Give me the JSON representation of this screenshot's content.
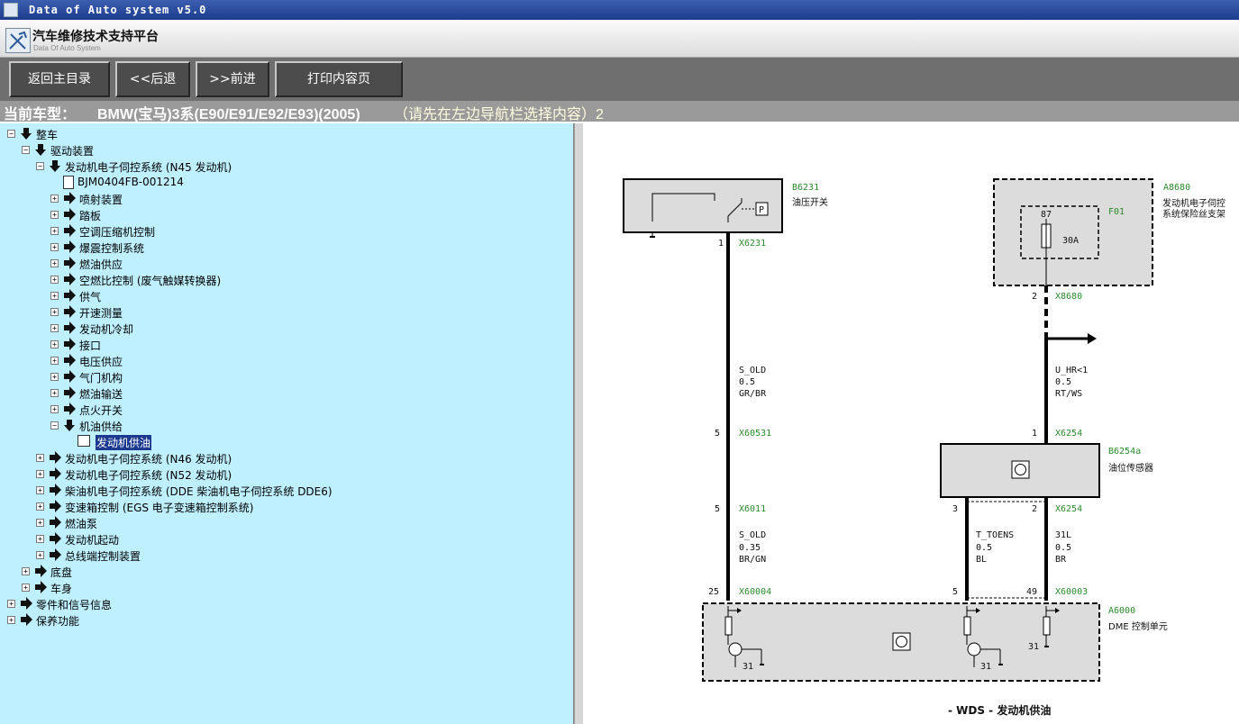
{
  "window": {
    "title": "Data of Auto system v5.0"
  },
  "brand": {
    "name": "汽车维修技术支持平台",
    "subtitle": "Data Of Auto System"
  },
  "toolbar": {
    "home": "返回主目录",
    "back": "<<后退",
    "forward": ">>前进",
    "print": "打印内容页"
  },
  "car": {
    "label": "当前车型：",
    "model": "BMW(宝马)3系(E90/E91/E92/E93)(2005)",
    "hint": "（请先在左边导航栏选择内容）2"
  },
  "tree": [
    {
      "label": "整车",
      "exp": "−",
      "arrow": "down"
    },
    {
      "label": "驱动装置",
      "exp": "−",
      "arrow": "down"
    },
    {
      "label": "发动机电子伺控系统 (N45 发动机)",
      "exp": "−",
      "arrow": "down"
    },
    {
      "label": "BJM0404FB-001214",
      "exp": "",
      "arrow": "doc"
    },
    {
      "label": "喷射装置",
      "exp": "+",
      "arrow": "right"
    },
    {
      "label": "踏板",
      "exp": "+",
      "arrow": "right"
    },
    {
      "label": "空调压缩机控制",
      "exp": "+",
      "arrow": "right"
    },
    {
      "label": "爆震控制系统",
      "exp": "+",
      "arrow": "right"
    },
    {
      "label": "燃油供应",
      "exp": "+",
      "arrow": "right"
    },
    {
      "label": "空燃比控制 (废气触媒转换器)",
      "exp": "+",
      "arrow": "right"
    },
    {
      "label": "供气",
      "exp": "+",
      "arrow": "right"
    },
    {
      "label": "开速测量",
      "exp": "+",
      "arrow": "right"
    },
    {
      "label": "发动机冷却",
      "exp": "+",
      "arrow": "right"
    },
    {
      "label": "接口",
      "exp": "+",
      "arrow": "right"
    },
    {
      "label": "电压供应",
      "exp": "+",
      "arrow": "right"
    },
    {
      "label": "气门机构",
      "exp": "+",
      "arrow": "right"
    },
    {
      "label": "燃油输送",
      "exp": "+",
      "arrow": "right"
    },
    {
      "label": "点火开关",
      "exp": "+",
      "arrow": "right"
    },
    {
      "label": "机油供给",
      "exp": "−",
      "arrow": "down"
    },
    {
      "label": "发动机供油",
      "exp": "",
      "arrow": "page",
      "selected": true
    },
    {
      "label": "发动机电子伺控系统 (N46 发动机)",
      "exp": "+",
      "arrow": "right"
    },
    {
      "label": "发动机电子伺控系统 (N52 发动机)",
      "exp": "+",
      "arrow": "right"
    },
    {
      "label": "柴油机电子伺控系统 (DDE 柴油机电子伺控系统 DDE6)",
      "exp": "+",
      "arrow": "right"
    },
    {
      "label": "变速箱控制 (EGS 电子变速箱控制系统)",
      "exp": "+",
      "arrow": "right"
    },
    {
      "label": "燃油泵",
      "exp": "+",
      "arrow": "right"
    },
    {
      "label": "发动机起动",
      "exp": "+",
      "arrow": "right"
    },
    {
      "label": "总线端控制装置",
      "exp": "+",
      "arrow": "right"
    },
    {
      "label": "底盘",
      "exp": "+",
      "arrow": "right"
    },
    {
      "label": "车身",
      "exp": "+",
      "arrow": "right"
    },
    {
      "label": "零件和信号信息",
      "exp": "+",
      "arrow": "right"
    },
    {
      "label": "保养功能",
      "exp": "+",
      "arrow": "right"
    }
  ],
  "diagram": {
    "b6231_code": "B6231",
    "b6231_name": "油压开关",
    "p_box": "P",
    "a8680_code": "A8680",
    "a8680_name1": "发动机电子伺控",
    "a8680_name2": "系统保险丝支架",
    "f01": "F01",
    "fuse_pin": "87",
    "fuse_rating": "30A",
    "pin_1a": "1",
    "x6231": "X6231",
    "pin_2a": "2",
    "x8680": "X8680",
    "w1_name": "S_OLD",
    "w1_size": "0.5",
    "w1_color": "GR/BR",
    "w2_name": "U_HR<1",
    "w2_size": "0.5",
    "w2_color": "RT/WS",
    "pin_5a": "5",
    "x60531": "X60531",
    "pin_1b": "1",
    "x6254a": "X6254",
    "b6254_code": "B6254a",
    "b6254_name": "油位传感器",
    "pin_5b": "5",
    "x6011": "X6011",
    "pin_3": "3",
    "pin_2b": "2",
    "x6254b": "X6254",
    "w3_name": "S_OLD",
    "w3_size": "0.35",
    "w3_color": "BR/GN",
    "w4_name": "T_TOENS",
    "w4_size": "0.5",
    "w4_color": "BL",
    "w5_name": "31L",
    "w5_size": "0.5",
    "w5_color": "BR",
    "pin_25": "25",
    "x60004": "X60004",
    "pin_5c": "5",
    "pin_49": "49",
    "x60003": "X60003",
    "a6000_code": "A6000",
    "a6000_name": "DME 控制单元",
    "gnd1": "31",
    "gnd2": "31",
    "gnd3": "31",
    "caption": "- WDS - 发动机供油"
  }
}
